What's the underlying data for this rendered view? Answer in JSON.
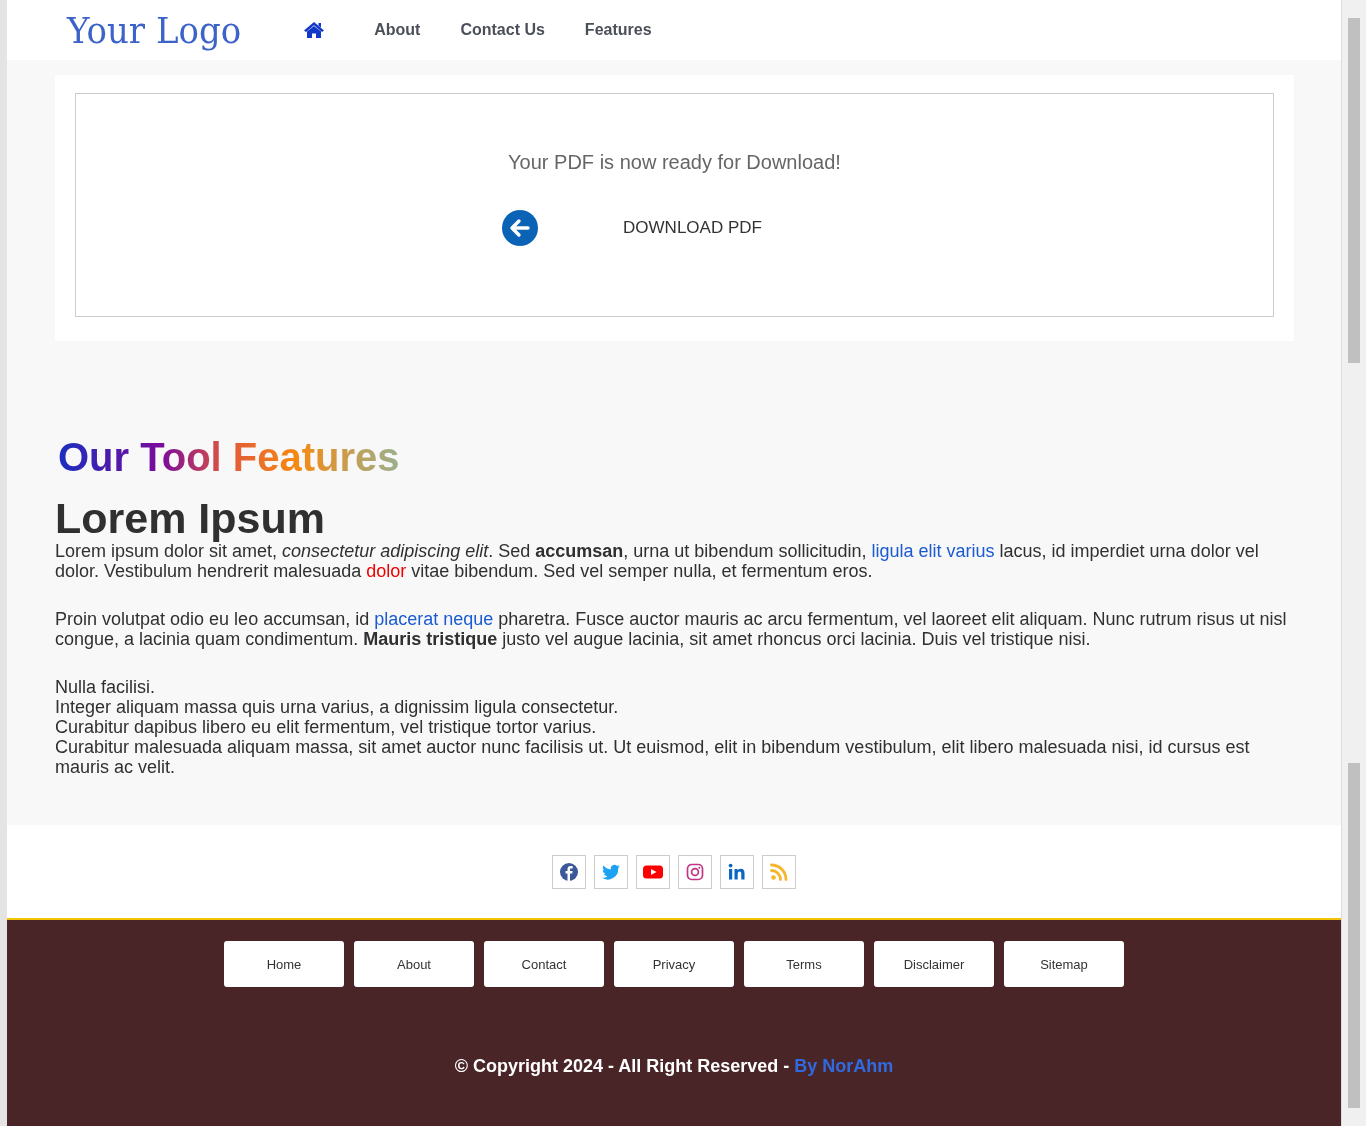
{
  "header": {
    "logo": "Your Logo",
    "nav": [
      {
        "kind": "home"
      },
      {
        "kind": "text",
        "label": "About"
      },
      {
        "kind": "text",
        "label": "Contact Us"
      },
      {
        "kind": "text",
        "label": "Features"
      }
    ]
  },
  "download": {
    "message": "Your PDF is now ready for Download!",
    "button": "DOWNLOAD PDF"
  },
  "features": {
    "title": "Our Tool Features",
    "heading": "Lorem Ipsum",
    "paragraphs": [
      [
        {
          "kind": "plain",
          "text": "Lorem ipsum dolor sit amet, "
        },
        {
          "kind": "italic",
          "text": "consectetur adipiscing elit"
        },
        {
          "kind": "plain",
          "text": ". Sed "
        },
        {
          "kind": "bold",
          "text": "accumsan"
        },
        {
          "kind": "plain",
          "text": ", urna ut bibendum sollicitudin, "
        },
        {
          "kind": "link",
          "text": "ligula elit varius"
        },
        {
          "kind": "plain",
          "text": " lacus, id imperdiet urna dolor vel dolor. Vestibulum hendrerit malesuada "
        },
        {
          "kind": "red",
          "text": "dolor"
        },
        {
          "kind": "plain",
          "text": " vitae bibendum. Sed vel semper nulla, et fermentum eros."
        }
      ],
      [
        {
          "kind": "plain",
          "text": "Proin volutpat odio eu leo accumsan, id "
        },
        {
          "kind": "link",
          "text": "placerat neque"
        },
        {
          "kind": "plain",
          "text": " pharetra. Fusce auctor mauris ac arcu fermentum, vel laoreet elit aliquam. Nunc rutrum risus ut nisl congue, a lacinia quam condimentum. "
        },
        {
          "kind": "bold",
          "text": "Mauris tristique"
        },
        {
          "kind": "plain",
          "text": " justo vel augue lacinia, sit amet rhoncus orci lacinia. Duis vel tristique nisi."
        }
      ]
    ],
    "lines": [
      "Nulla facilisi.",
      "Integer aliquam massa quis urna varius, a dignissim ligula consectetur.",
      "Curabitur dapibus libero eu elit fermentum, vel tristique tortor varius.",
      "Curabitur malesuada aliquam massa, sit amet auctor nunc facilisis ut. Ut euismod, elit in bibendum vestibulum, elit libero malesuada nisi, id cursus est mauris ac velit."
    ]
  },
  "social": [
    {
      "kind": "facebook",
      "color": "#3b5998"
    },
    {
      "kind": "twitter",
      "color": "#1da1f2"
    },
    {
      "kind": "youtube",
      "color": "#ff0000"
    },
    {
      "kind": "instagram",
      "color": "#c13584"
    },
    {
      "kind": "linkedin",
      "color": "#0a66c2"
    },
    {
      "kind": "rss",
      "color": "#f7b52b"
    }
  ],
  "footer": {
    "links": [
      "Home",
      "About",
      "Contact",
      "Privacy",
      "Terms",
      "Disclaimer",
      "Sitemap"
    ],
    "copyright": "© Copyright 2024 - All Right Reserved - ",
    "author": "By NorAhm"
  }
}
